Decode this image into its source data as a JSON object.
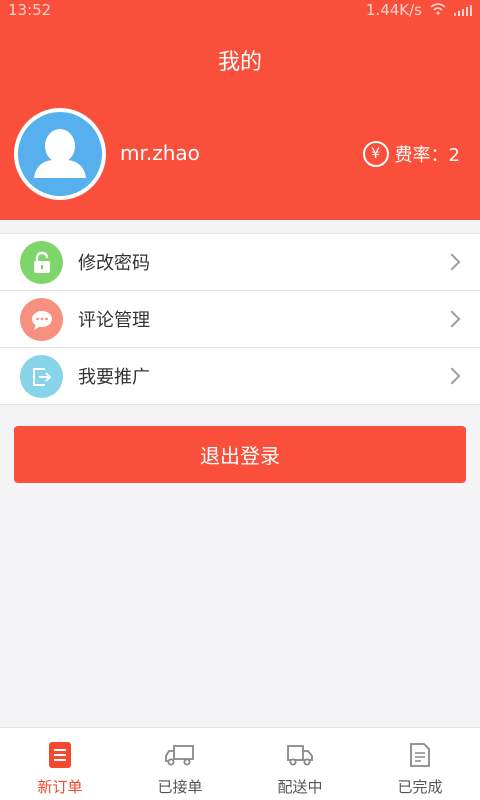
{
  "status_bar": {
    "time": "13:52",
    "network_speed": "1.44K/s"
  },
  "header": {
    "title": "我的"
  },
  "profile": {
    "username": "mr.zhao",
    "rate_label": "费率：2",
    "rate_icon_glyph": "¥"
  },
  "menu": {
    "items": [
      {
        "label": "修改密码",
        "icon": "lock-icon",
        "color": "#7ed66b"
      },
      {
        "label": "评论管理",
        "icon": "comment-icon",
        "color": "#f8907f"
      },
      {
        "label": "我要推广",
        "icon": "share-icon",
        "color": "#86d3ea"
      }
    ]
  },
  "logout": {
    "label": "退出登录"
  },
  "tabbar": {
    "tabs": [
      {
        "label": "新订单",
        "icon": "list-icon",
        "active": true
      },
      {
        "label": "已接单",
        "icon": "truck-icon",
        "active": false
      },
      {
        "label": "配送中",
        "icon": "delivery-truck-icon",
        "active": false
      },
      {
        "label": "已完成",
        "icon": "document-icon",
        "active": false
      }
    ]
  },
  "colors": {
    "accent": "#fa503b",
    "active_tab": "#f2492f",
    "avatar_bg": "#56b0ee"
  }
}
